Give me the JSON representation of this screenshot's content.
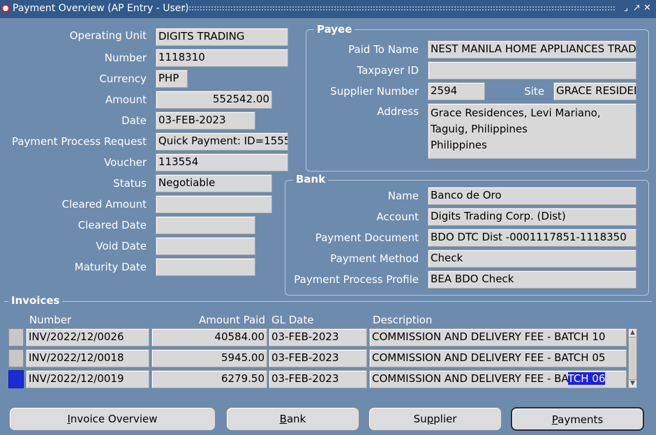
{
  "window": {
    "title": "Payment Overview (AP Entry - User)",
    "controls": [
      "⌟",
      "↗",
      "✕"
    ]
  },
  "left": {
    "operating_unit": {
      "label": "Operating Unit",
      "value": "DIGITS TRADING"
    },
    "number": {
      "label": "Number",
      "value": "1118310"
    },
    "currency": {
      "label": "Currency",
      "value": "PHP"
    },
    "amount": {
      "label": "Amount",
      "value": "552542.00"
    },
    "date": {
      "label": "Date",
      "value": "03-FEB-2023"
    },
    "ppr": {
      "label": "Payment Process Request",
      "value": "Quick Payment: ID=1555"
    },
    "voucher": {
      "label": "Voucher",
      "value": "113554"
    },
    "status": {
      "label": "Status",
      "value": "Negotiable"
    },
    "cleared_amount": {
      "label": "Cleared Amount",
      "value": ""
    },
    "cleared_date": {
      "label": "Cleared Date",
      "value": ""
    },
    "void_date": {
      "label": "Void Date",
      "value": ""
    },
    "maturity_date": {
      "label": "Maturity Date",
      "value": ""
    }
  },
  "payee": {
    "title": "Payee",
    "paid_to_name": {
      "label": "Paid To Name",
      "value": "NEST MANILA HOME APPLIANCES TRADING"
    },
    "taxpayer_id": {
      "label": "Taxpayer ID",
      "value": ""
    },
    "supplier_number": {
      "label": "Supplier Number",
      "value": "2594"
    },
    "site": {
      "label": "Site",
      "value": "GRACE RESIDENCES"
    },
    "address": {
      "label": "Address",
      "value": "Grace Residences, Levi Mariano,\nTaguig, Philippines\nPhilippines"
    }
  },
  "bank": {
    "title": "Bank",
    "name": {
      "label": "Name",
      "value": "Banco de Oro"
    },
    "account": {
      "label": "Account",
      "value": "Digits Trading Corp. (Dist)"
    },
    "payment_document": {
      "label": "Payment Document",
      "value": "BDO DTC Dist -0001117851-1118350"
    },
    "payment_method": {
      "label": "Payment Method",
      "value": "Check"
    },
    "payment_process_profile": {
      "label": "Payment Process Profile",
      "value": "BEA BDO Check"
    }
  },
  "invoices": {
    "title": "Invoices",
    "columns": {
      "number": "Number",
      "amount_paid": "Amount Paid",
      "gl_date": "GL Date",
      "description": "Description"
    },
    "rows": [
      {
        "number": "INV/2022/12/0026",
        "amount_paid": "40584.00",
        "gl_date": "03-FEB-2023",
        "description": "COMMISSION AND DELIVERY FEE - BATCH 10",
        "desc_tail": ""
      },
      {
        "number": "INV/2022/12/0018",
        "amount_paid": "5945.00",
        "gl_date": "03-FEB-2023",
        "description": "COMMISSION AND DELIVERY FEE - BATCH 05",
        "desc_tail": ""
      },
      {
        "number": "INV/2022/12/0019",
        "amount_paid": "6279.50",
        "gl_date": "03-FEB-2023",
        "description": "COMMISSION AND DELIVERY FEE - BA",
        "desc_tail": "TCH 06"
      }
    ]
  },
  "buttons": {
    "invoice_overview": {
      "mn": "I",
      "rest": "nvoice Overview"
    },
    "bank": {
      "mn": "B",
      "rest": "ank"
    },
    "supplier": {
      "pre": "Su",
      "mn": "p",
      "rest": "plier"
    },
    "payments": {
      "mn": "P",
      "rest": "ayments"
    }
  },
  "colors": {
    "background": "#6d8bad",
    "titlebar": "#31598a",
    "field": "#d8d8d8",
    "highlight": "#1c20e8"
  }
}
